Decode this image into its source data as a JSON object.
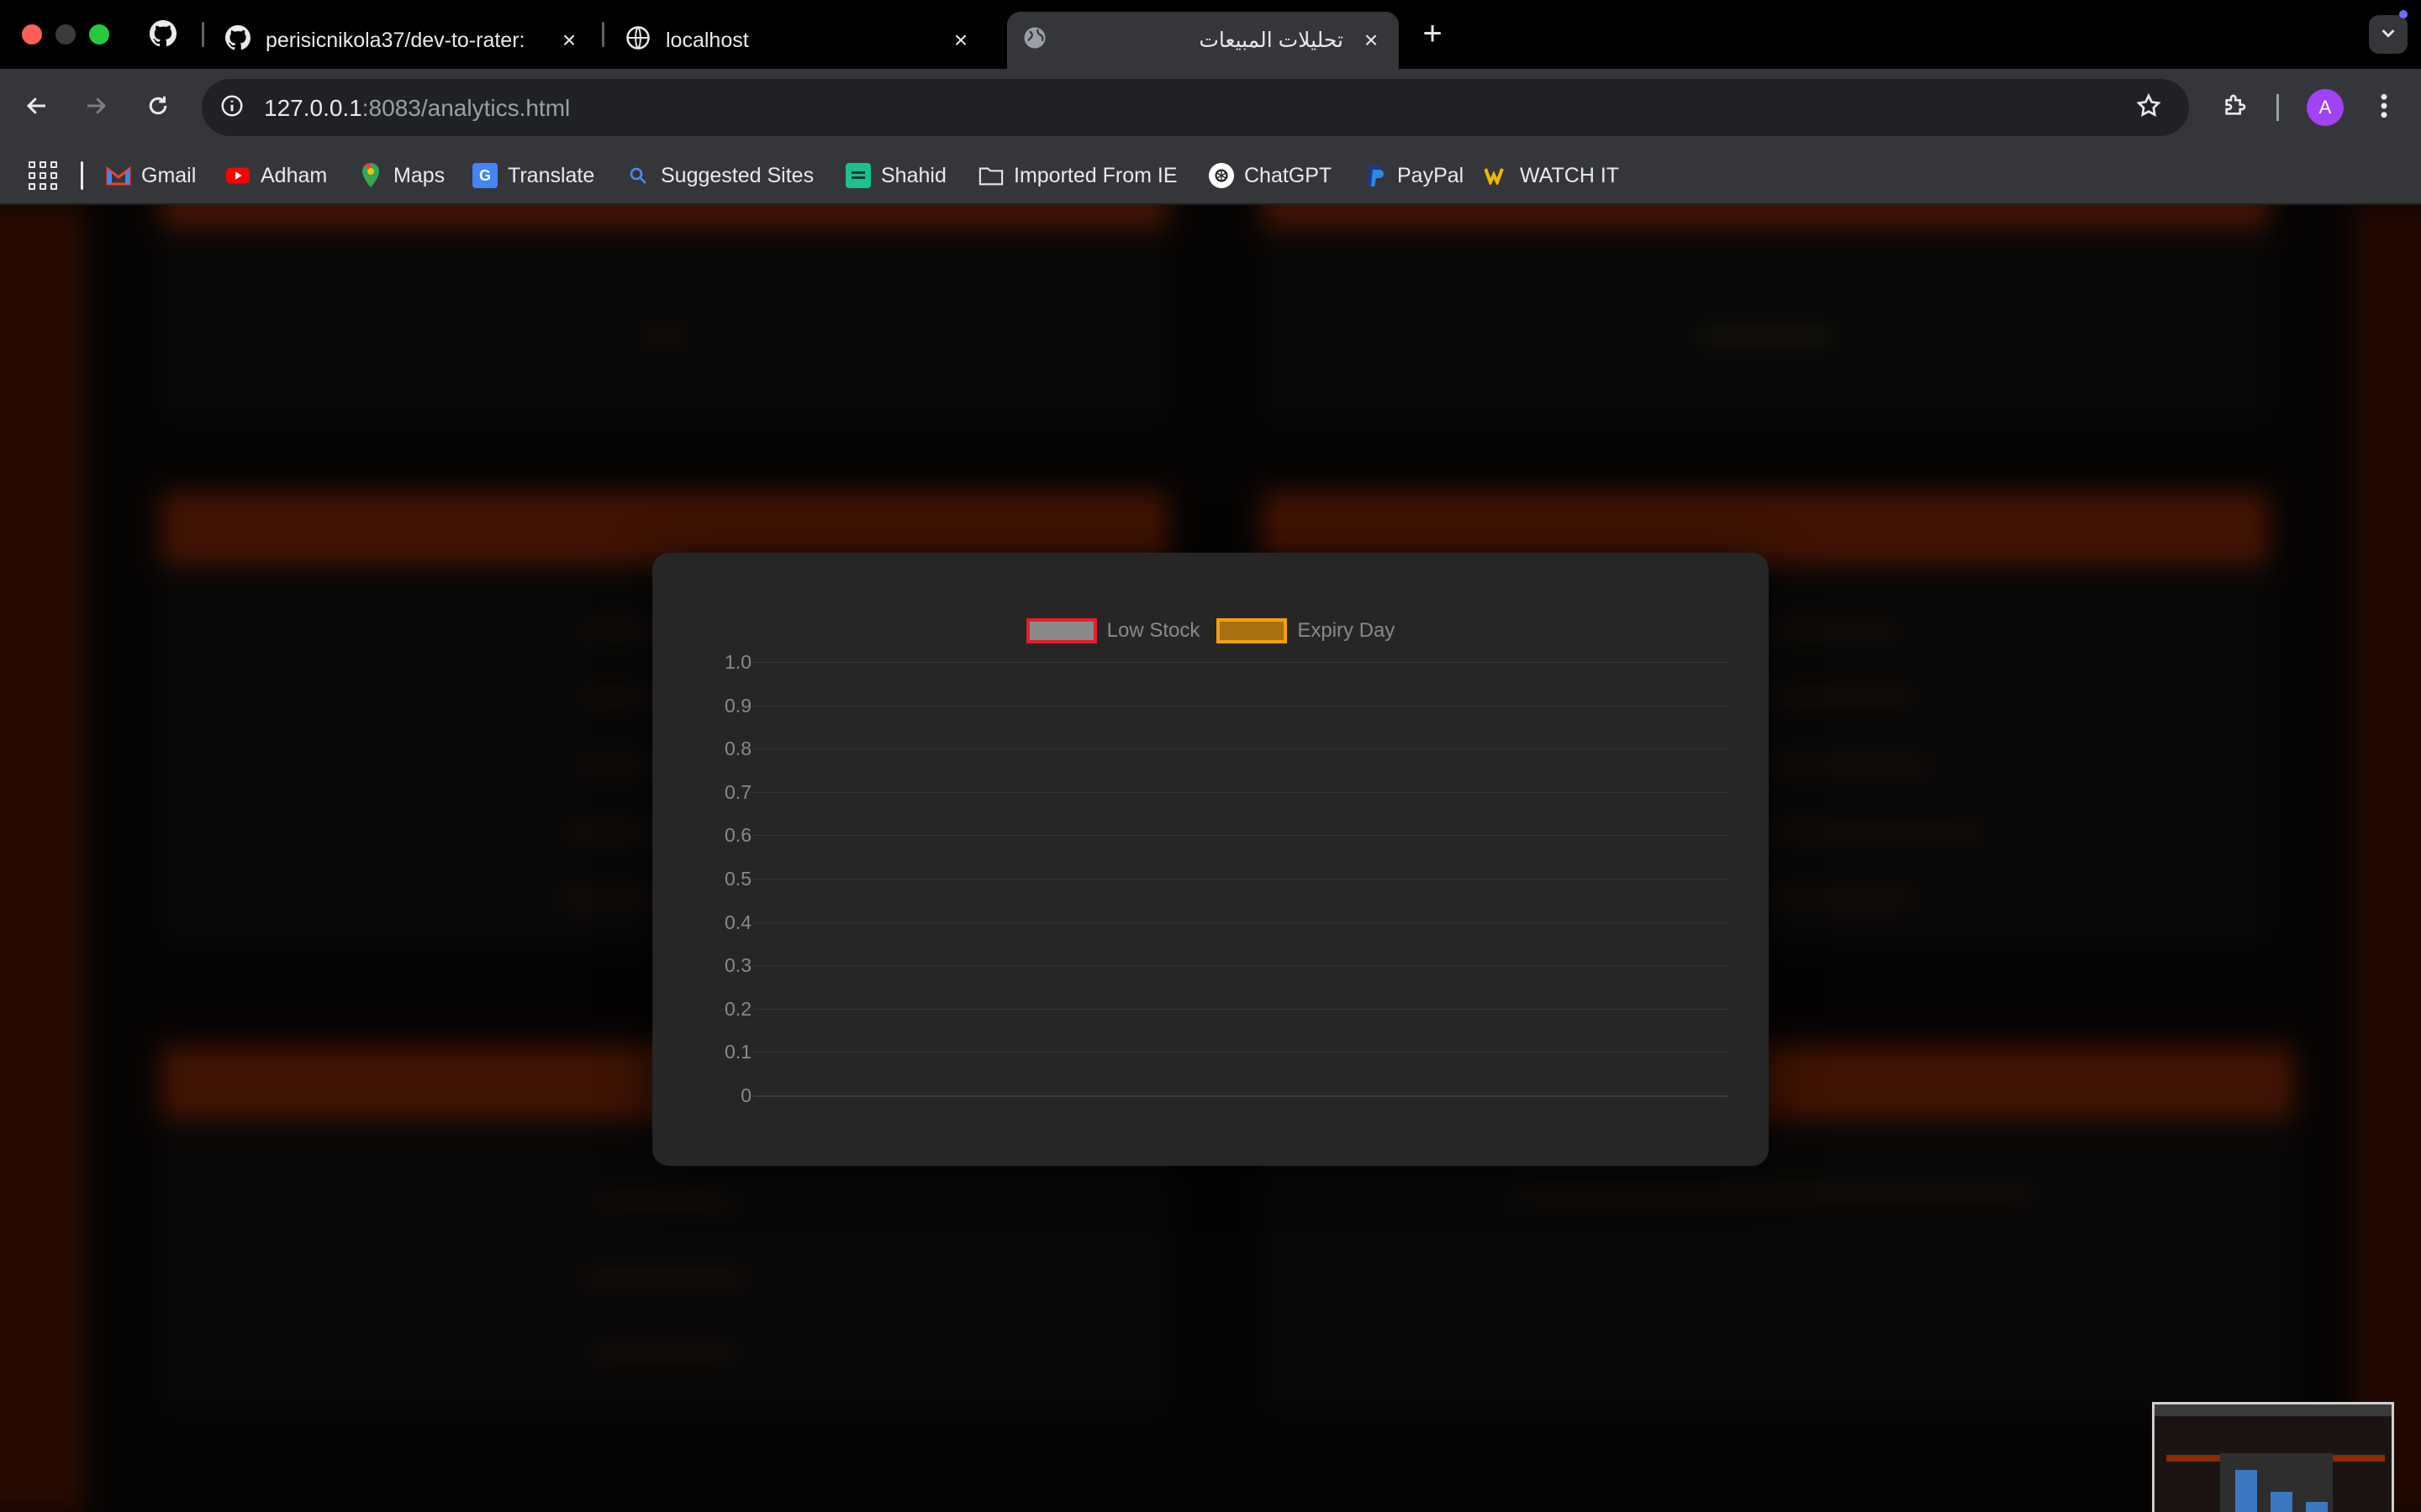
{
  "browser": {
    "tabs": [
      {
        "title": "perisicnikola37/dev-to-rater: ",
        "icon": "github-icon",
        "active": false
      },
      {
        "title": "localhost",
        "icon": "globe-icon",
        "active": false
      },
      {
        "title": "تحليلات المبيعات",
        "icon": "globe-icon",
        "active": true
      }
    ],
    "new_tab_label": "+",
    "address": {
      "host": "127.0.0.1",
      "path": ":8083/analytics.html"
    },
    "profile_initial": "A",
    "bookmarks": [
      {
        "label": "Gmail",
        "icon": "gmail-icon",
        "color": "#ea4335"
      },
      {
        "label": "Adham",
        "icon": "youtube-icon",
        "color": "#ff0000"
      },
      {
        "label": "Maps",
        "icon": "maps-icon",
        "color": "#34a853"
      },
      {
        "label": "Translate",
        "icon": "translate-icon",
        "color": "#4285f4"
      },
      {
        "label": "Suggested Sites",
        "icon": "search-icon",
        "color": "#4c8bf5"
      },
      {
        "label": "Shahid",
        "icon": "shahid-icon",
        "color": "#1fbf8f"
      },
      {
        "label": "Imported From IE",
        "icon": "folder-icon",
        "color": "#e8eaed"
      },
      {
        "label": "ChatGPT",
        "icon": "chatgpt-icon",
        "color": "#ffffff"
      },
      {
        "label": "PayPal",
        "icon": "paypal-icon",
        "color": "#1e5bc6"
      },
      {
        "label": "WATCH IT",
        "icon": "watchit-icon",
        "color": "#f2b705"
      }
    ]
  },
  "chart_data": {
    "type": "bar",
    "categories": [],
    "series": [
      {
        "name": "Low Stock",
        "values": [],
        "color": "#e0202a",
        "fill": "#8a8a8a"
      },
      {
        "name": "Expiry Day",
        "values": [],
        "color": "#f0a010",
        "fill": "#a87010"
      }
    ],
    "ylim": [
      0,
      1.0
    ],
    "yticks": [
      "1.0",
      "0.9",
      "0.8",
      "0.7",
      "0.6",
      "0.5",
      "0.4",
      "0.3",
      "0.2",
      "0.1",
      "0"
    ],
    "grid": true,
    "legend": "top-center"
  }
}
